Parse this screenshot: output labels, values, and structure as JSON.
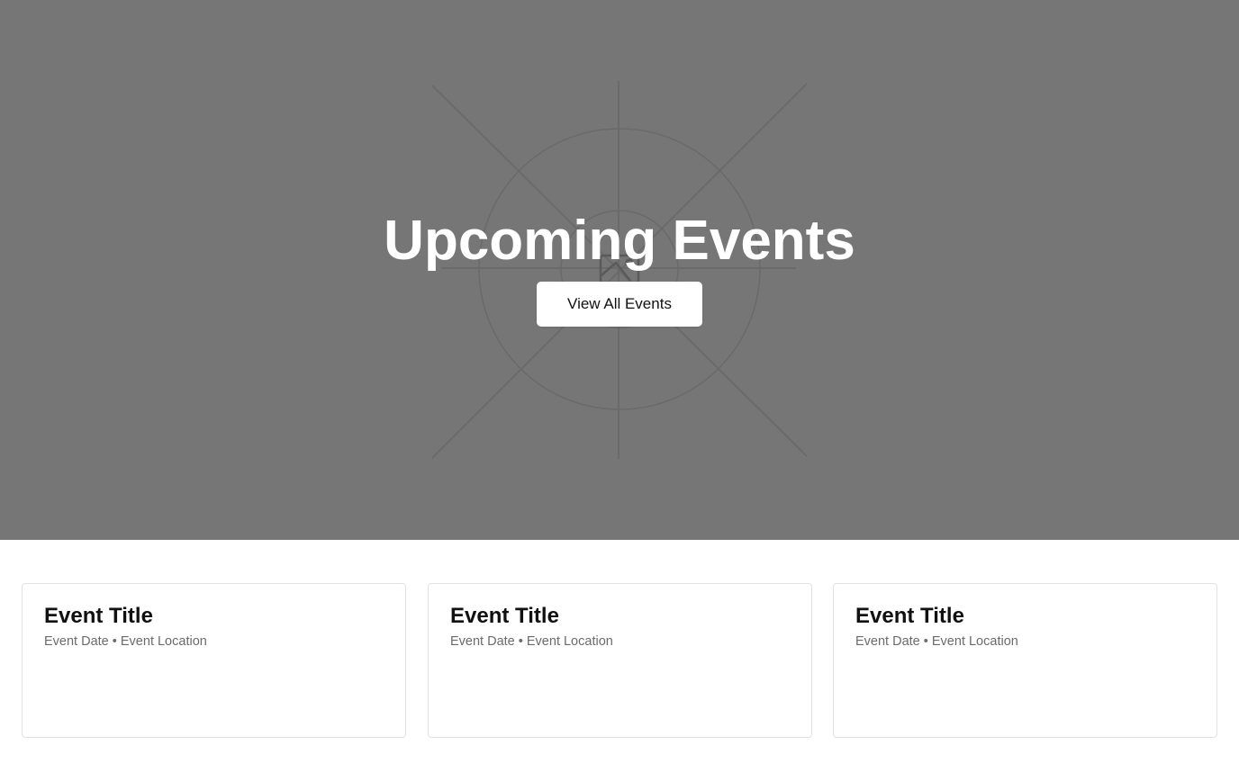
{
  "hero": {
    "title": "Upcoming Events",
    "button_label": "View All Events",
    "background_color": "#767676",
    "placeholder_icon": "image-placeholder-icon"
  },
  "events": [
    {
      "title": "Event Title",
      "date": "Event Date",
      "separator": "•",
      "location": "Event Location"
    },
    {
      "title": "Event Title",
      "date": "Event Date",
      "separator": "•",
      "location": "Event Location"
    },
    {
      "title": "Event Title",
      "date": "Event Date",
      "separator": "•",
      "location": "Event Location"
    }
  ]
}
